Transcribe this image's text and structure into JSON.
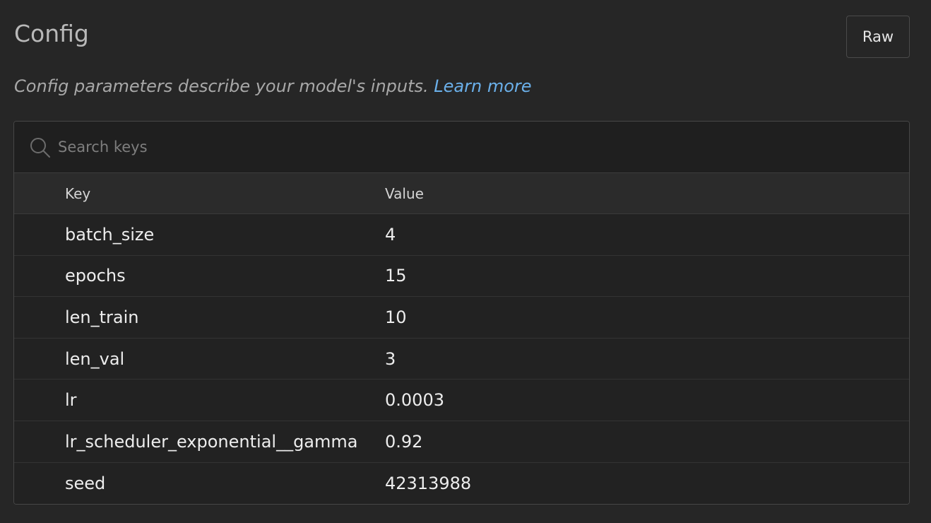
{
  "header": {
    "title": "Config",
    "raw_label": "Raw"
  },
  "subtitle": {
    "text": "Config parameters describe your model's inputs. ",
    "link": "Learn more"
  },
  "search": {
    "placeholder": "Search keys"
  },
  "table": {
    "columns": {
      "key": "Key",
      "value": "Value"
    },
    "rows": [
      {
        "key": "batch_size",
        "value": "4"
      },
      {
        "key": "epochs",
        "value": "15"
      },
      {
        "key": "len_train",
        "value": "10"
      },
      {
        "key": "len_val",
        "value": "3"
      },
      {
        "key": "lr",
        "value": "0.0003"
      },
      {
        "key": "lr_scheduler_exponential__gamma",
        "value": "0.92"
      },
      {
        "key": "seed",
        "value": "42313988"
      }
    ]
  },
  "colors": {
    "background": "#262626",
    "link": "#6bb0ea"
  },
  "icons": {
    "search": "search-icon"
  }
}
